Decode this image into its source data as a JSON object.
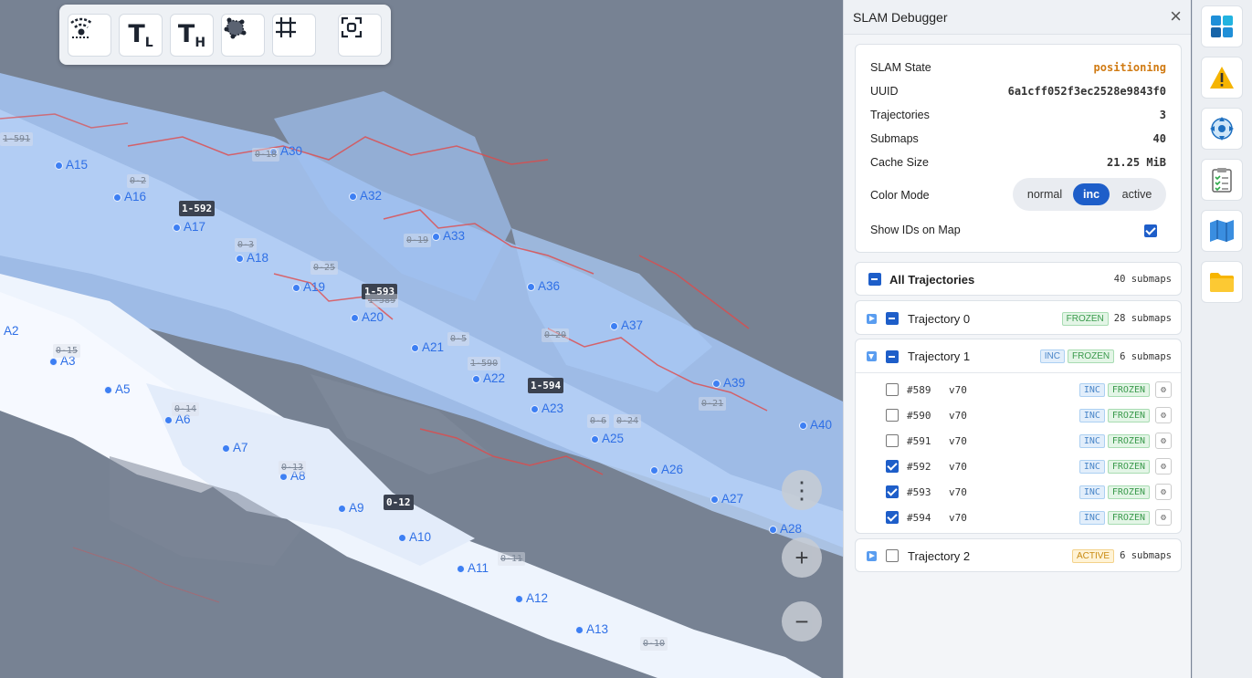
{
  "map": {
    "toolbar": {
      "tool_tl": "T",
      "tool_tl_sub": "L",
      "tool_th": "T",
      "tool_th_sub": "H"
    },
    "fabs": {
      "menu": "⋮",
      "zoom_in": "+",
      "zoom_out": "−"
    },
    "anchors": [
      {
        "label": "A2"
      },
      {
        "label": "A3"
      },
      {
        "label": "A5"
      },
      {
        "label": "A6"
      },
      {
        "label": "A7"
      },
      {
        "label": "A8"
      },
      {
        "label": "A9"
      },
      {
        "label": "A10"
      },
      {
        "label": "A11"
      },
      {
        "label": "A12"
      },
      {
        "label": "A13"
      },
      {
        "label": "A15"
      },
      {
        "label": "A16"
      },
      {
        "label": "A17"
      },
      {
        "label": "A18"
      },
      {
        "label": "A19"
      },
      {
        "label": "A20"
      },
      {
        "label": "A21"
      },
      {
        "label": "A22"
      },
      {
        "label": "A23"
      },
      {
        "label": "A25"
      },
      {
        "label": "A26"
      },
      {
        "label": "A27"
      },
      {
        "label": "A28"
      },
      {
        "label": "A30"
      },
      {
        "label": "A32"
      },
      {
        "label": "A33"
      },
      {
        "label": "A36"
      },
      {
        "label": "A37"
      },
      {
        "label": "A39"
      },
      {
        "label": "A40"
      }
    ],
    "submap_tags": [
      {
        "text": "1-592",
        "style": "dark"
      },
      {
        "text": "1-593",
        "style": "dark"
      },
      {
        "text": "1-594",
        "style": "dark"
      },
      {
        "text": "0-12",
        "style": "dark"
      },
      {
        "text": "1-591",
        "style": "ghost"
      },
      {
        "text": "0-18",
        "style": "ghost"
      },
      {
        "text": "0-2",
        "style": "ghost"
      },
      {
        "text": "0-3",
        "style": "ghost"
      },
      {
        "text": "0-25",
        "style": "ghost"
      },
      {
        "text": "1-589",
        "style": "ghost"
      },
      {
        "text": "0-19",
        "style": "ghost"
      },
      {
        "text": "0-5",
        "style": "ghost"
      },
      {
        "text": "0-20",
        "style": "ghost"
      },
      {
        "text": "1-590",
        "style": "ghost"
      },
      {
        "text": "0-15",
        "style": "ghost"
      },
      {
        "text": "0-14",
        "style": "ghost"
      },
      {
        "text": "0-13",
        "style": "ghost"
      },
      {
        "text": "0-6",
        "style": "ghost"
      },
      {
        "text": "0-24",
        "style": "ghost"
      },
      {
        "text": "0-21",
        "style": "ghost"
      },
      {
        "text": "0-11",
        "style": "ghost"
      },
      {
        "text": "0-10",
        "style": "ghost"
      }
    ]
  },
  "panel": {
    "title": "SLAM Debugger",
    "close": "×",
    "info": {
      "state_label": "SLAM State",
      "state_value": "positioning",
      "uuid_label": "UUID",
      "uuid_value": "6a1cff052f3ec2528e9843f0",
      "traj_label": "Trajectories",
      "traj_value": "3",
      "submaps_label": "Submaps",
      "submaps_value": "40",
      "cache_label": "Cache Size",
      "cache_value": "21.25 MiB",
      "color_mode_label": "Color Mode",
      "color_modes": [
        "normal",
        "inc",
        "active"
      ],
      "color_mode_selected": "inc",
      "show_ids_label": "Show IDs on Map",
      "show_ids_checked": true
    },
    "all_trajectories": {
      "label": "All Trajectories",
      "count": "40 submaps"
    },
    "trajectories": [
      {
        "label": "Trajectory 0",
        "badges": [
          "FROZEN"
        ],
        "count": "28 submaps",
        "expanded": false
      },
      {
        "label": "Trajectory 1",
        "badges": [
          "INC",
          "FROZEN"
        ],
        "count": "6 submaps",
        "expanded": true,
        "submaps": [
          {
            "id": "#589",
            "version": "v70",
            "checked": false,
            "badges": [
              "INC",
              "FROZEN"
            ]
          },
          {
            "id": "#590",
            "version": "v70",
            "checked": false,
            "badges": [
              "INC",
              "FROZEN"
            ]
          },
          {
            "id": "#591",
            "version": "v70",
            "checked": false,
            "badges": [
              "INC",
              "FROZEN"
            ]
          },
          {
            "id": "#592",
            "version": "v70",
            "checked": true,
            "badges": [
              "INC",
              "FROZEN"
            ]
          },
          {
            "id": "#593",
            "version": "v70",
            "checked": true,
            "badges": [
              "INC",
              "FROZEN"
            ]
          },
          {
            "id": "#594",
            "version": "v70",
            "checked": true,
            "badges": [
              "INC",
              "FROZEN"
            ]
          }
        ]
      },
      {
        "label": "Trajectory 2",
        "badges": [
          "ACTIVE"
        ],
        "count": "6 submaps",
        "expanded": false
      }
    ]
  },
  "rail": {
    "buttons": [
      "dashboard-icon",
      "warning-icon",
      "navigation-icon",
      "checklist-icon",
      "map-icon",
      "folder-icon"
    ]
  },
  "colors": {
    "accent": "#1e5ec9",
    "map_bg": "#778293",
    "scan": "#a9c9f5",
    "wall": "#e04a4a",
    "warning": "#f5b400"
  }
}
